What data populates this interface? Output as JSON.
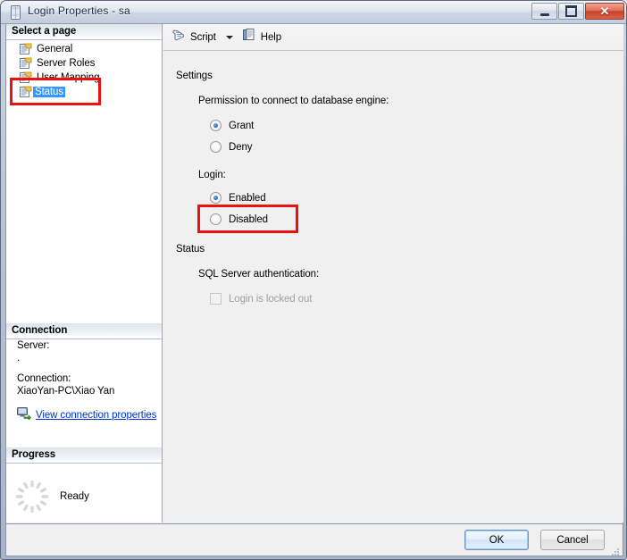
{
  "window": {
    "title": "Login Properties - sa",
    "icon": "table-icon",
    "buttons": {
      "minimize": "minimize-button",
      "maximize": "maximize-button",
      "close": "close-button"
    }
  },
  "sidebar": {
    "select_page_header": "Select a page",
    "items": [
      {
        "label": "General",
        "icon": "page-icon",
        "selected": false
      },
      {
        "label": "Server Roles",
        "icon": "page-icon",
        "selected": false
      },
      {
        "label": "User Mapping",
        "icon": "page-icon",
        "selected": false
      },
      {
        "label": "Status",
        "icon": "page-icon",
        "selected": true
      }
    ],
    "connection": {
      "header": "Connection",
      "server_label": "Server:",
      "server_value": ".",
      "connection_label": "Connection:",
      "connection_value": "XiaoYan-PC\\Xiao Yan",
      "link": "View connection properties",
      "link_icon": "server-connection-icon"
    },
    "progress": {
      "header": "Progress",
      "status": "Ready",
      "icon": "spinner-icon"
    }
  },
  "toolbar": {
    "script_label": "Script",
    "script_icon": "script-scroll-icon",
    "dropdown_icon": "chevron-down-icon",
    "help_label": "Help",
    "help_icon": "help-book-icon"
  },
  "main": {
    "settings_group": "Settings",
    "permission_label": "Permission to connect to database engine:",
    "permission_options": [
      {
        "label": "Grant",
        "selected": true
      },
      {
        "label": "Deny",
        "selected": false
      }
    ],
    "login_label": "Login:",
    "login_options": [
      {
        "label": "Enabled",
        "selected": true
      },
      {
        "label": "Disabled",
        "selected": false
      }
    ],
    "status_group": "Status",
    "auth_label": "SQL Server authentication:",
    "locked_out": {
      "label": "Login is locked out",
      "checked": false,
      "disabled": true
    }
  },
  "footer": {
    "ok_label": "OK",
    "cancel_label": "Cancel"
  },
  "annotations": {
    "highlight_color": "#ee1111",
    "boxes": [
      {
        "name": "status-page-highlight",
        "target": "Status"
      },
      {
        "name": "enabled-radio-highlight",
        "target": "Enabled"
      }
    ]
  }
}
